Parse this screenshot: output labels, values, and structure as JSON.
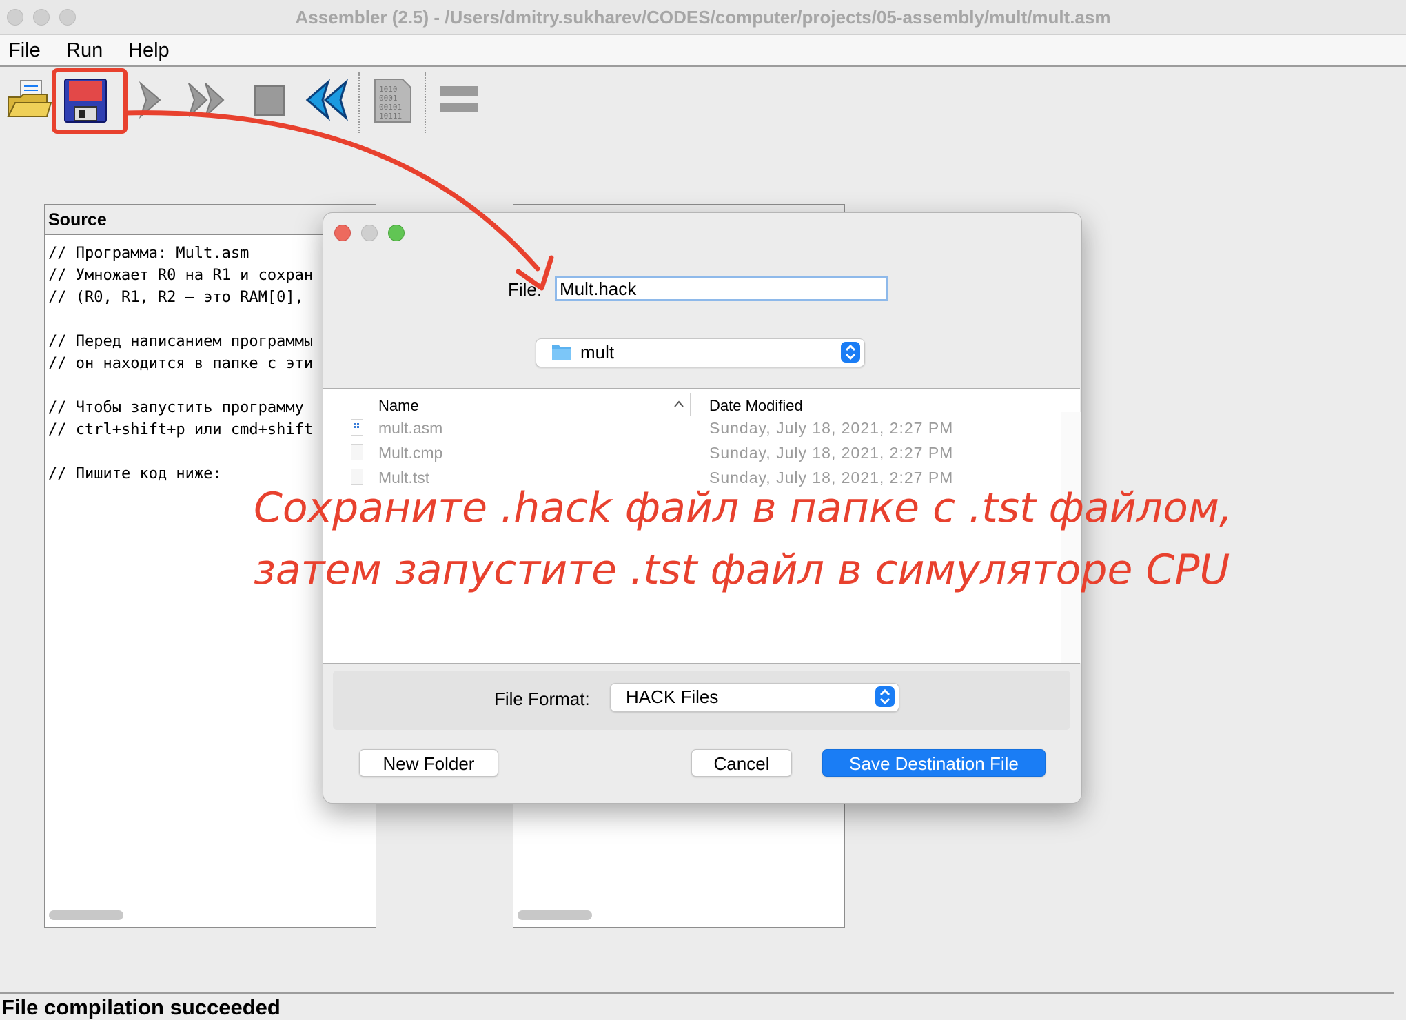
{
  "window": {
    "title": "Assembler (2.5) - /Users/dmitry.sukharev/CODES/computer/projects/05-assembly/mult/mult.asm"
  },
  "menu": {
    "file": "File",
    "run": "Run",
    "help": "Help"
  },
  "toolbar": {
    "icons": [
      "open-folder-icon",
      "save-disk-icon",
      "single-step-icon",
      "fast-forward-icon",
      "stop-icon",
      "rewind-icon",
      "binary-file-icon",
      "equal-bars-icon"
    ]
  },
  "source_panel": {
    "header": "Source",
    "lines": [
      "// Программа: Mult.asm",
      "// Умножает R0 на R1 и сохран",
      "// (R0, R1, R2 — это RAM[0],",
      "",
      "// Перед написанием программы",
      "// он находится в папке с эти",
      "",
      "// Чтобы запустить программу",
      "// ctrl+shift+p или cmd+shift",
      "",
      "// Пишите код ниже:"
    ]
  },
  "dialog": {
    "file_label": "File:",
    "file_value": "Mult.hack",
    "folder": "mult",
    "columns": {
      "name": "Name",
      "date": "Date Modified"
    },
    "files": [
      {
        "name": "mult.asm",
        "date": "Sunday, July 18, 2021, 2:27 PM"
      },
      {
        "name": "Mult.cmp",
        "date": "Sunday, July 18, 2021, 2:27 PM"
      },
      {
        "name": "Mult.tst",
        "date": "Sunday, July 18, 2021, 2:27 PM"
      }
    ],
    "format_label": "File Format:",
    "format_value": "HACK Files",
    "new_folder": "New Folder",
    "cancel": "Cancel",
    "save": "Save Destination File"
  },
  "annotation": {
    "line1": "Сохраните .hack файл в папке с .tst файлом,",
    "line2": "затем запустите .tst файл в симуляторе CPU",
    "color": "#e8412e"
  },
  "status": "File compilation succeeded",
  "colors": {
    "accent": "#1a7df5",
    "annotation": "#e8412e"
  }
}
